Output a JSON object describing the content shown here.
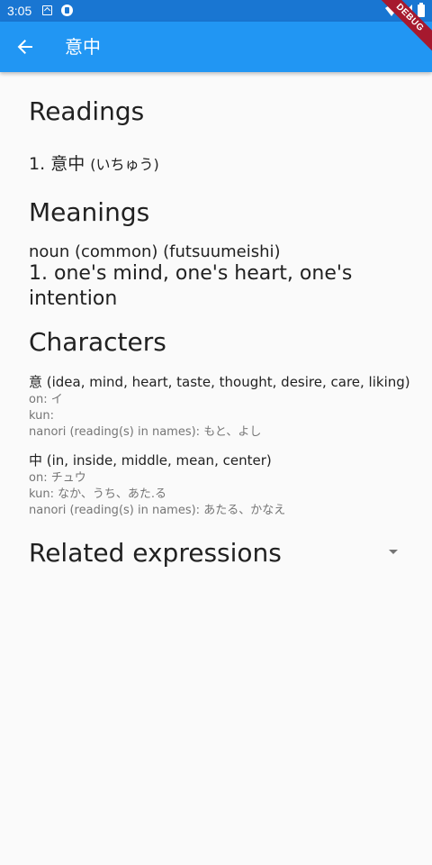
{
  "status_bar": {
    "time": "3:05"
  },
  "app_bar": {
    "title": "意中"
  },
  "debug_banner": "DEBUG",
  "readings": {
    "heading": "Readings",
    "items": [
      {
        "number": "1.",
        "kanji": "意中",
        "kana": "(いちゅう)"
      }
    ]
  },
  "meanings": {
    "heading": "Meanings",
    "part_of_speech": "noun (common) (futsuumeishi)",
    "gloss": "1. one's mind, one's heart, one's intention"
  },
  "characters": {
    "heading": "Characters",
    "items": [
      {
        "header": "意 (idea, mind, heart, taste, thought, desire, care, liking)",
        "on": "on: イ",
        "kun": "kun:",
        "nanori": "nanori (reading(s) in names): もと、よし"
      },
      {
        "header": "中 (in, inside, middle, mean, center)",
        "on": "on: チュウ",
        "kun": "kun: なか、うち、あた.る",
        "nanori": "nanori (reading(s) in names): あたる、かなえ"
      }
    ]
  },
  "related": {
    "heading": "Related expressions"
  },
  "colors": {
    "status_bar": "#1976d2",
    "app_bar": "#2196f3",
    "debug_banner": "#a6192e",
    "background": "#fafafa"
  },
  "icons": {
    "back": "arrow-back-icon",
    "dropdown": "arrow-drop-down-icon",
    "wifi": "wifi-icon",
    "signal": "signal-icon",
    "battery": "battery-icon"
  }
}
